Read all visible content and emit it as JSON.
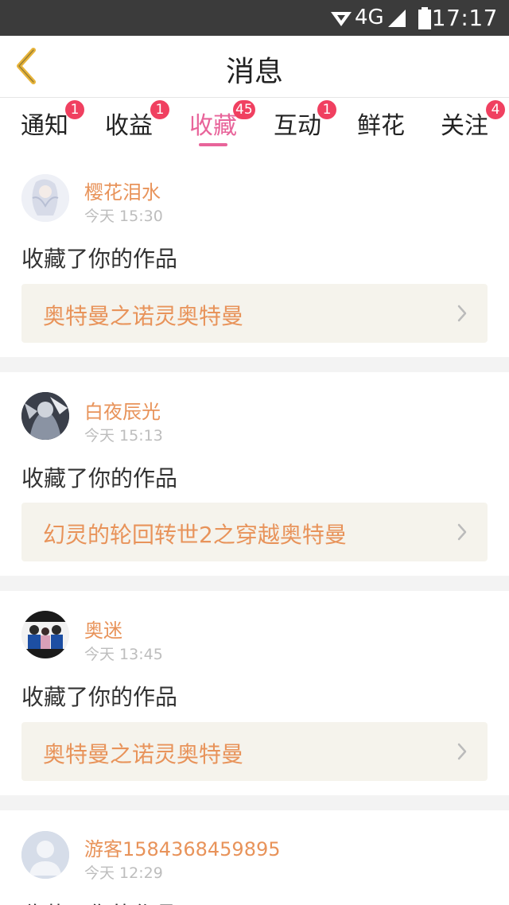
{
  "status_bar": {
    "network": "4G",
    "time": "17:17"
  },
  "header": {
    "title": "消息"
  },
  "tabs": [
    {
      "label": "通知",
      "badge": "1"
    },
    {
      "label": "收益",
      "badge": "1"
    },
    {
      "label": "收藏",
      "badge": "45",
      "active": true
    },
    {
      "label": "互动",
      "badge": "1"
    },
    {
      "label": "鲜花",
      "badge": ""
    },
    {
      "label": "关注",
      "badge": "4"
    }
  ],
  "messages": [
    {
      "user": "樱花泪水",
      "time": "今天 15:30",
      "action": "收藏了你的作品",
      "work": "奥特曼之诺灵奥特曼"
    },
    {
      "user": "白夜辰光",
      "time": "今天 15:13",
      "action": "收藏了你的作品",
      "work": "幻灵的轮回转世2之穿越奥特曼"
    },
    {
      "user": "奥迷",
      "time": "今天 13:45",
      "action": "收藏了你的作品",
      "work": "奥特曼之诺灵奥特曼"
    },
    {
      "user": "游客1584368459895",
      "time": "今天 12:29",
      "action": "收藏了你的作品",
      "work": ""
    }
  ],
  "colors": {
    "accent": "#e8649a",
    "username": "#e8935a",
    "badge": "#f04060",
    "back": "#e8b43a"
  }
}
